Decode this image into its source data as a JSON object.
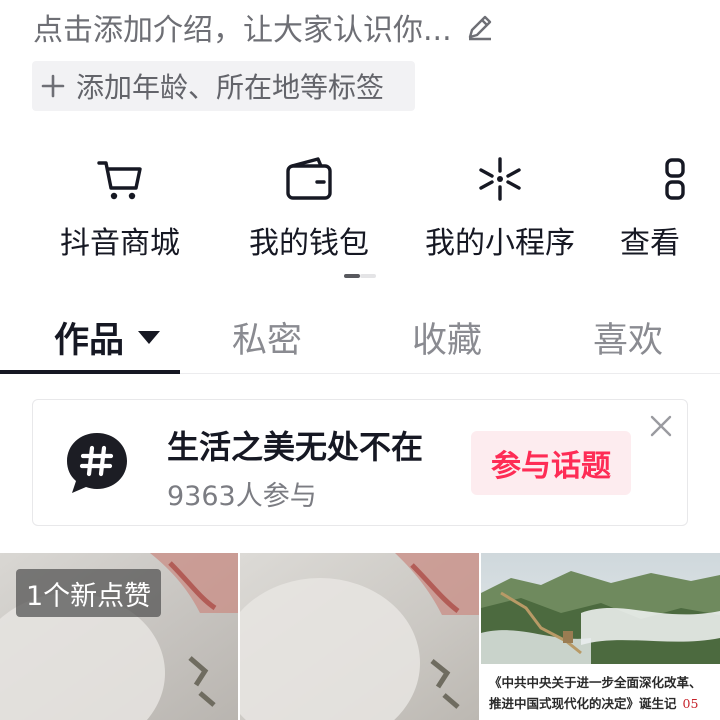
{
  "profile": {
    "intro_placeholder": "点击添加介绍，让大家认识你...",
    "tag_chip_label": "添加年龄、所在地等标签"
  },
  "services": [
    {
      "label": "抖音商城",
      "icon": "cart-icon"
    },
    {
      "label": "我的钱包",
      "icon": "wallet-icon"
    },
    {
      "label": "我的小程序",
      "icon": "mini-program-icon"
    },
    {
      "label": "查看",
      "icon": "view-icon"
    }
  ],
  "pager": {
    "current": 1,
    "total": 2
  },
  "tabs": [
    {
      "label": "作品",
      "active": true
    },
    {
      "label": "私密",
      "active": false
    },
    {
      "label": "收藏",
      "active": false
    },
    {
      "label": "喜欢",
      "active": false
    }
  ],
  "topic": {
    "title": "生活之美无处不在",
    "count": "9363人参与",
    "join_label": "参与话题"
  },
  "videos": [
    {
      "badge": "1个新点赞"
    },
    {
      "badge": ""
    },
    {
      "caption": "《中共中央关于进一步全面深化改革、推进中国式现代化的决定》诞生记",
      "page": "05"
    }
  ],
  "colors": {
    "accent": "#fe2c55",
    "accent_bg": "#fdecef",
    "text_primary": "#161823",
    "text_secondary": "#8a8b91"
  }
}
